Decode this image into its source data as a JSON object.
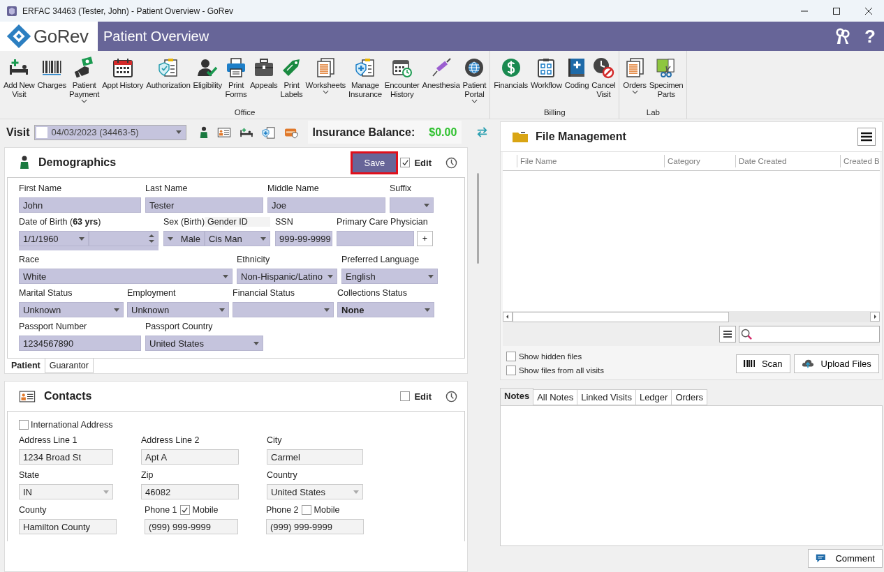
{
  "window": {
    "title": "ERFAC 34463 (Tester, John) - Patient Overview - GoRev"
  },
  "header": {
    "logo": "GoRev",
    "title": "Patient Overview",
    "help": "?"
  },
  "ribbon": [
    {
      "name": "Office",
      "items": [
        {
          "label": "Add New\nVisit",
          "dropdown": false
        },
        {
          "label": "Charges",
          "dropdown": false
        },
        {
          "label": "Patient\nPayment",
          "dropdown": true
        },
        {
          "label": "Appt History",
          "dropdown": false
        },
        {
          "label": "Authorization",
          "dropdown": false
        },
        {
          "label": "Eligibility",
          "dropdown": false
        },
        {
          "label": "Print\nForms",
          "dropdown": false
        },
        {
          "label": "Appeals",
          "dropdown": false
        },
        {
          "label": "Print\nLabels",
          "dropdown": false
        },
        {
          "label": "Worksheets",
          "dropdown": true
        },
        {
          "label": "Manage\nInsurance",
          "dropdown": false
        },
        {
          "label": "Encounter\nHistory",
          "dropdown": false
        },
        {
          "label": "Anesthesia",
          "dropdown": false
        },
        {
          "label": "Patient\nPortal",
          "dropdown": true
        }
      ]
    },
    {
      "name": "Billing",
      "items": [
        {
          "label": "Financials",
          "dropdown": false
        },
        {
          "label": "Workflow",
          "dropdown": false
        },
        {
          "label": "Coding",
          "dropdown": false
        },
        {
          "label": "Cancel\nVisit",
          "dropdown": false
        }
      ]
    },
    {
      "name": "Lab",
      "items": [
        {
          "label": "Orders",
          "dropdown": true
        },
        {
          "label": "Specimen\nParts",
          "dropdown": false
        }
      ]
    }
  ],
  "visit_bar": {
    "label": "Visit",
    "checked": false,
    "value": "04/03/2023 (34463-5)",
    "balance_label": "Insurance Balance:",
    "balance": "$0.00"
  },
  "demographics": {
    "title": "Demographics",
    "save": "Save",
    "save_highlighted": true,
    "edit_label": "Edit",
    "edit_checked": true,
    "lines": [
      {
        "fields": [
          {
            "label": "First Name",
            "value": "John",
            "kind": "text"
          },
          {
            "label": "Last Name",
            "value": "Tester",
            "kind": "text"
          },
          {
            "label": "Middle Name",
            "value": "Joe",
            "kind": "text"
          },
          {
            "label": "Suffix",
            "kind": "select"
          }
        ]
      },
      {
        "fields": [
          {
            "label": "Date of Birth (**63 yrs**)",
            "value": "1/1/1960",
            "kind": "date"
          },
          {
            "label": "Sex (Birth)",
            "value": "Male",
            "kind": "select-left"
          },
          {
            "label": "Gender ID",
            "value": "Cis Man",
            "kind": "select"
          },
          {
            "label": "SSN",
            "value": "999-99-9999",
            "kind": "text"
          },
          {
            "label": "Primary Care Physician",
            "kind": "lookup",
            "button": "+"
          }
        ]
      },
      {
        "fields": [
          {
            "label": "Race",
            "value": "White",
            "kind": "select"
          },
          {
            "label": "Ethnicity",
            "value": "Non-Hispanic/Latino",
            "kind": "select"
          },
          {
            "label": "Preferred Language",
            "value": "English",
            "kind": "select"
          }
        ]
      },
      {
        "fields": [
          {
            "label": "Marital Status",
            "value": "Unknown",
            "kind": "select"
          },
          {
            "label": "Employment",
            "value": "Unknown",
            "kind": "select"
          },
          {
            "label": "Financial Status",
            "kind": "select"
          },
          {
            "label": "Collections Status",
            "value": "None",
            "kind": "select",
            "bold": true
          }
        ]
      },
      {
        "fields": [
          {
            "label": "Passport Number",
            "value": "1234567890",
            "kind": "text"
          },
          {
            "label": "Passport Country",
            "value": "United States",
            "kind": "select"
          }
        ]
      }
    ],
    "tabs": [
      {
        "label": "Patient",
        "selected": true
      },
      {
        "label": "Guarantor",
        "selected": false
      }
    ]
  },
  "contacts": {
    "title": "Contacts",
    "edit_label": "Edit",
    "edit_checked": false,
    "international": {
      "label": "International Address",
      "checked": false
    },
    "rows": [
      [
        {
          "label": "Address Line 1",
          "value": "1234 Broad St",
          "kind": "text"
        },
        {
          "label": "Address Line 2",
          "value": "Apt A",
          "kind": "text"
        },
        {
          "label": "City",
          "value": "Carmel",
          "kind": "text"
        }
      ],
      [
        {
          "label": "State",
          "value": "IN",
          "kind": "select"
        },
        {
          "label": "Zip",
          "value": "46082",
          "kind": "text"
        },
        {
          "label": "Country",
          "value": "United States",
          "kind": "select"
        }
      ],
      [
        {
          "label": "County",
          "value": "Hamilton County",
          "kind": "text"
        },
        {
          "label": "Phone 1",
          "check_label": "Mobile",
          "checked": true,
          "value": "(999) 999-9999",
          "kind": "phone"
        },
        {
          "label": "Phone 2",
          "check_label": "Mobile",
          "checked": false,
          "value": "(999) 999-9999",
          "kind": "phone"
        }
      ]
    ]
  },
  "file_management": {
    "title": "File Management",
    "columns": [
      "File Name",
      "Category",
      "Date Created",
      "Created B"
    ],
    "options": [
      {
        "label": "Show hidden files",
        "checked": false
      },
      {
        "label": "Show files from all visits",
        "checked": false
      }
    ],
    "scan": "Scan",
    "upload": "Upload Files"
  },
  "notes_tabs": [
    {
      "label": "Notes",
      "selected": true
    },
    {
      "label": "All Notes",
      "selected": false
    },
    {
      "label": "Linked Visits",
      "selected": false
    },
    {
      "label": "Ledger",
      "selected": false
    },
    {
      "label": "Orders",
      "selected": false
    }
  ],
  "comment": "Comment"
}
